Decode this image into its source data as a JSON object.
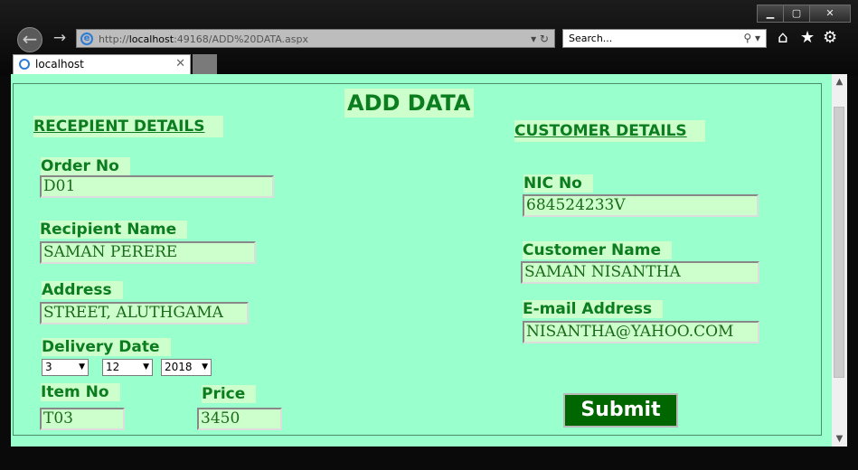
{
  "browser": {
    "window_controls": {
      "minimize": "▁",
      "maximize": "▢",
      "close": "✕"
    },
    "url": {
      "scheme": "http://",
      "host": "localhost",
      "path": ":49168/ADD%20DATA.aspx"
    },
    "search_placeholder": "Search...",
    "tab_title": "localhost"
  },
  "page": {
    "title": "ADD DATA",
    "recipient_section": "RECEPIENT DETAILS",
    "customer_section": "CUSTOMER DETAILS",
    "order_no": {
      "label": "Order No",
      "value": "D01"
    },
    "recipient_name": {
      "label": "Recipient Name",
      "value": "SAMAN PERERE"
    },
    "address": {
      "label": "Address",
      "value": " STREET, ALUTHGAMA"
    },
    "delivery_date": {
      "label": "Delivery Date",
      "day": "3",
      "month": "12",
      "year": "2018"
    },
    "item_no": {
      "label": "Item No",
      "value": "T03"
    },
    "price": {
      "label": "Price",
      "value": "3450"
    },
    "nic_no": {
      "label": "NIC No",
      "value": "684524233V"
    },
    "customer_name": {
      "label": "Customer Name",
      "value": "SAMAN NISANTHA"
    },
    "email": {
      "label": "E-mail Address",
      "value": "NISANTHA@YAHOO.COM"
    },
    "submit_label": "Submit"
  },
  "colors": {
    "page_bg": "#99ffcc",
    "label_bg": "#ccffcc",
    "label_text": "#0b7d1f",
    "button_bg": "#006600"
  }
}
